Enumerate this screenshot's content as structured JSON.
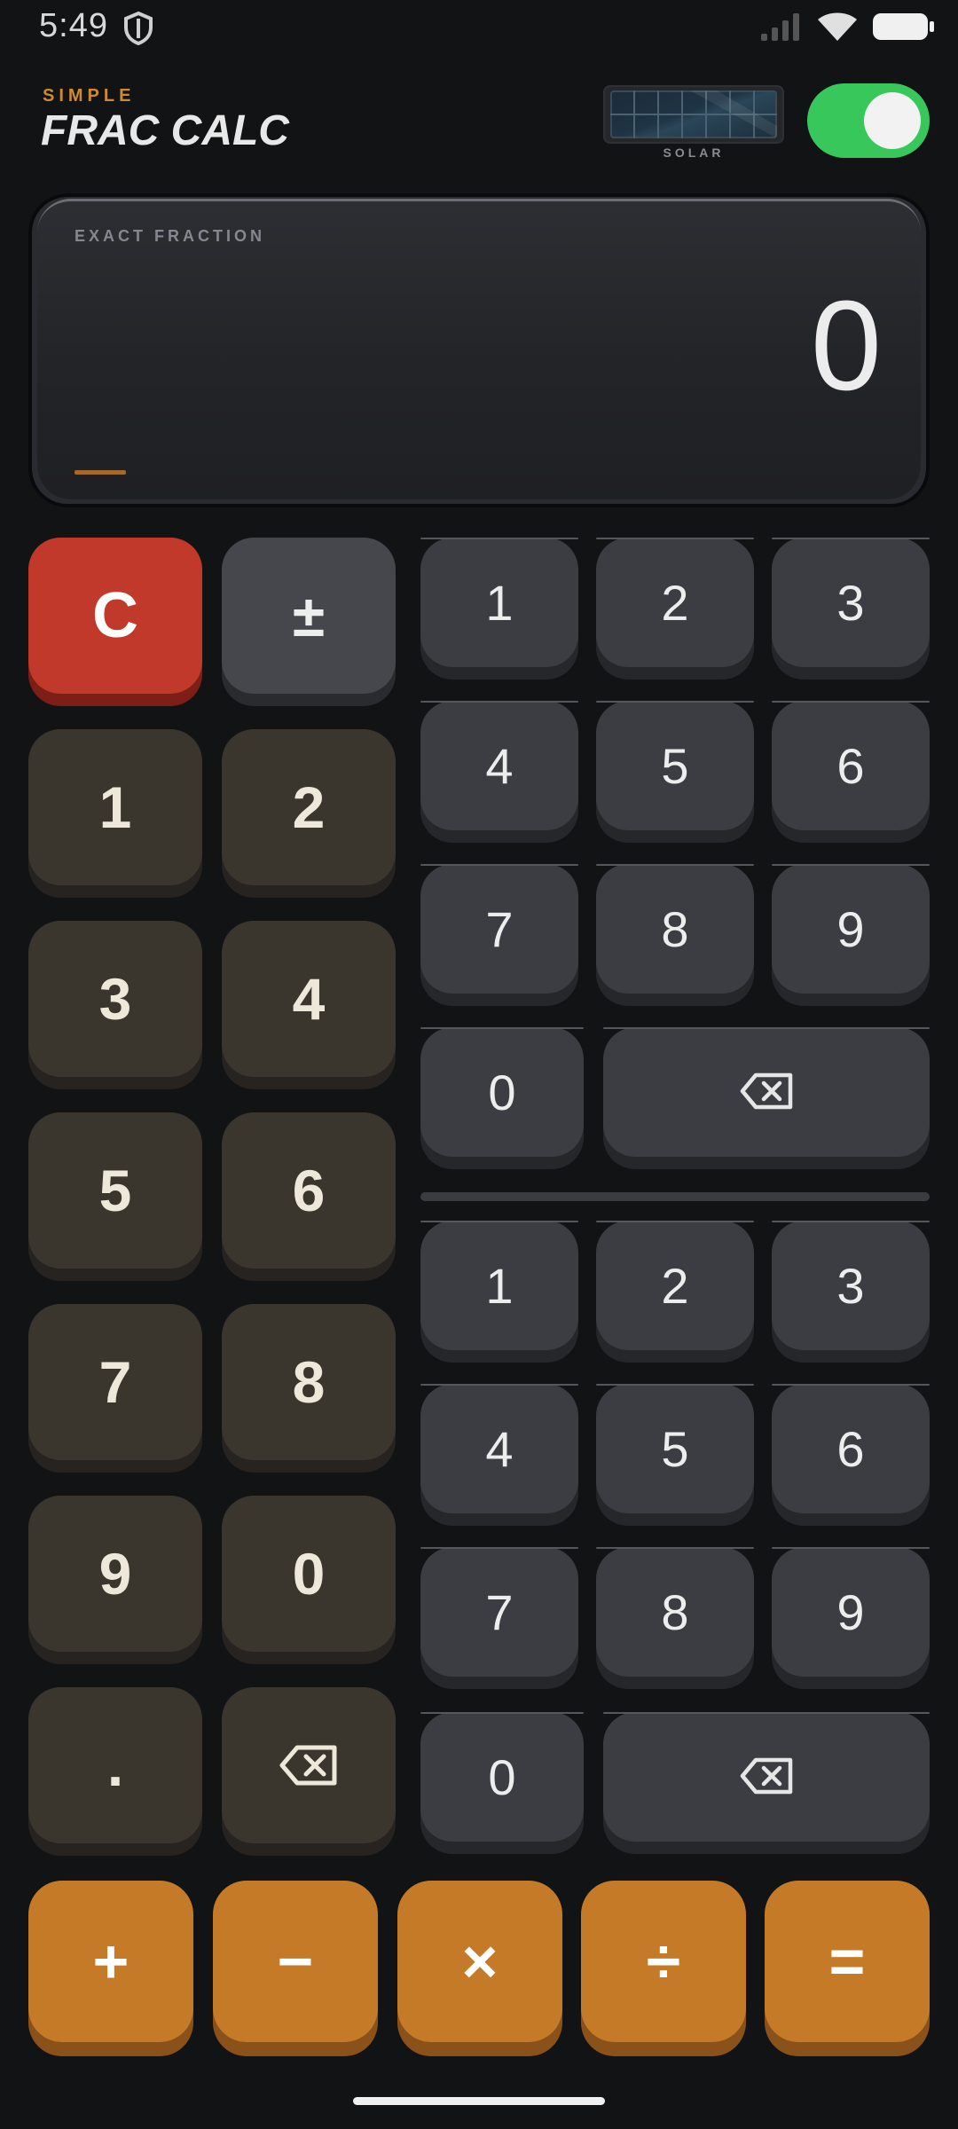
{
  "status": {
    "time": "5:49",
    "icons": [
      "shield-icon",
      "signal-icon",
      "wifi-icon",
      "battery-icon"
    ]
  },
  "header": {
    "brand_top": "SIMPLE",
    "brand_main": "FRAC CALC",
    "solar_label": "SOLAR",
    "toggle_on": true
  },
  "display": {
    "label": "EXACT FRACTION",
    "value": "0"
  },
  "left_pad": {
    "clear": "C",
    "sign": "±",
    "keys": [
      "1",
      "2",
      "3",
      "4",
      "5",
      "6",
      "7",
      "8",
      "9",
      "0",
      "."
    ],
    "backspace_icon": "backspace-icon"
  },
  "numerator_pad": {
    "keys": [
      "1",
      "2",
      "3",
      "4",
      "5",
      "6",
      "7",
      "8",
      "9",
      "0"
    ],
    "backspace_icon": "backspace-icon"
  },
  "denominator_pad": {
    "keys": [
      "1",
      "2",
      "3",
      "4",
      "5",
      "6",
      "7",
      "8",
      "9",
      "0"
    ],
    "backspace_icon": "backspace-icon"
  },
  "operators": {
    "add": "+",
    "subtract": "−",
    "multiply": "×",
    "divide": "÷",
    "equals": "="
  },
  "colors": {
    "accent": "#c57a28",
    "clear": "#c0392b",
    "toggle": "#37c75a"
  }
}
